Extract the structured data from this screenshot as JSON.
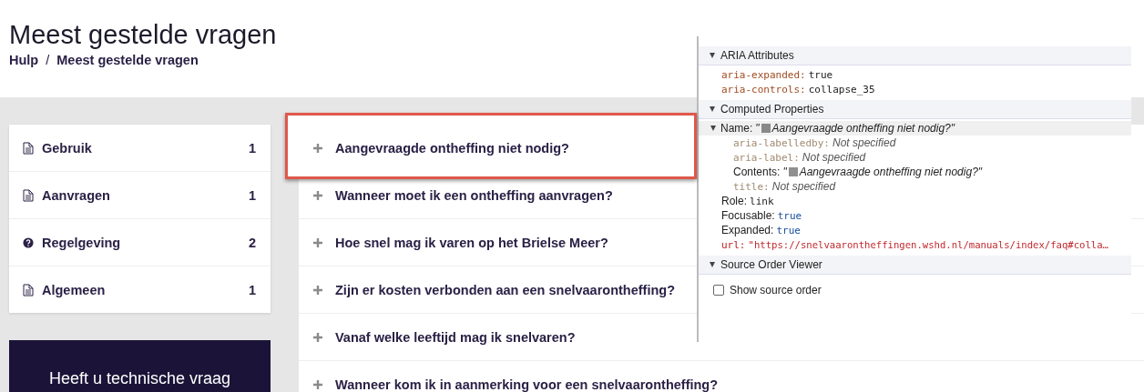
{
  "page": {
    "title": "Meest gestelde vragen",
    "separator": "/",
    "breadcrumb": [
      {
        "label": "Hulp"
      },
      {
        "label": "Meest gestelde vragen"
      }
    ]
  },
  "categories": [
    {
      "kind": "document",
      "label": "Gebruik",
      "count": "1"
    },
    {
      "kind": "document",
      "label": "Aanvragen",
      "count": "1"
    },
    {
      "kind": "question",
      "label": "Regelgeving",
      "count": "2"
    },
    {
      "kind": "document",
      "label": "Algemeen",
      "count": "1"
    }
  ],
  "help_box": {
    "text": "Heeft u technische vraag"
  },
  "faq": [
    {
      "question": "Aangevraagde ontheffing niet nodig?",
      "highlighted": true
    },
    {
      "question": "Wanneer moet ik een ontheffing aanvragen?",
      "highlighted": false
    },
    {
      "question": "Hoe snel mag ik varen op het Brielse Meer?",
      "highlighted": false
    },
    {
      "question": "Zijn er kosten verbonden aan een snelvaarontheffing?",
      "highlighted": false
    },
    {
      "question": "Vanaf welke leeftijd mag ik snelvaren?",
      "highlighted": false
    },
    {
      "question": "Wanneer kom ik in aanmerking voor een snelvaarontheffing?",
      "highlighted": false
    }
  ],
  "devtools": {
    "sections": [
      {
        "title": "ARIA Attributes",
        "expanded": true,
        "rows": [
          {
            "kind": "attribute",
            "key": "aria-expanded:",
            "value": "true"
          },
          {
            "kind": "attribute",
            "key": "aria-controls:",
            "value": "collapse_35"
          }
        ]
      },
      {
        "title": "Computed Properties",
        "expanded": true,
        "rows": [
          {
            "kind": "name",
            "key": "Name:",
            "expanded": true,
            "quote": "\"",
            "value": "Aangevraagde ontheffing niet nodig?\"",
            "children": [
              {
                "kind": "unspecified",
                "key": "aria-labelledby:",
                "value": "Not specified"
              },
              {
                "kind": "unspecified",
                "key": "aria-label:",
                "value": "Not specified"
              },
              {
                "kind": "name",
                "key": "Contents:",
                "quote": "\"",
                "value": "Aangevraagde ontheffing niet nodig?\""
              },
              {
                "kind": "unspecified",
                "key": "title:",
                "value": "Not specified"
              }
            ]
          },
          {
            "kind": "property",
            "key": "Role:",
            "value": "link"
          },
          {
            "kind": "flag",
            "key": "Focusable:",
            "value": "true"
          },
          {
            "kind": "flag",
            "key": "Expanded:",
            "value": "true"
          },
          {
            "kind": "url",
            "key": "url:",
            "value": "\"https://snelvaarontheffingen.wshd.nl/manuals/index/faq#colla…"
          }
        ]
      },
      {
        "title": "Source Order Viewer",
        "expanded": true,
        "checkbox": {
          "label": "Show source order",
          "checked": false
        }
      }
    ]
  }
}
